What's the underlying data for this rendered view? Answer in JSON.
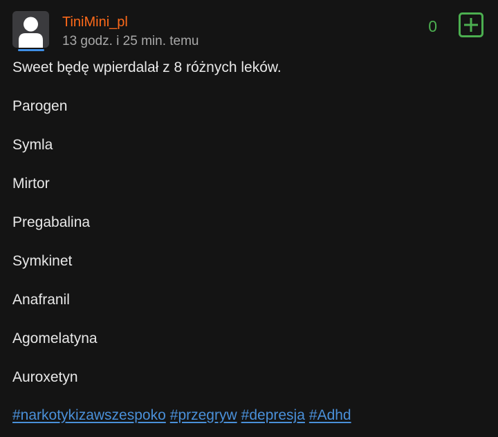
{
  "post": {
    "author": "TiniMini_pl",
    "timestamp": "13 godz. i 25 min. temu",
    "votes": "0",
    "lines": [
      "Sweet będę wpierdalał z 8 różnych leków.",
      "Parogen",
      "Symla",
      "Mirtor",
      "Pregabalina",
      "Symkinet",
      "Anafranil",
      "Agomelatyna",
      "Auroxetyn"
    ],
    "tags": [
      "#narkotykizawszespoko",
      "#przegryw",
      "#depresja",
      "#Adhd"
    ]
  },
  "colors": {
    "author": "#ff6a1a",
    "votes": "#4caf50",
    "tag": "#4a90d9",
    "avatar_bg": "#3b3b3e",
    "avatar_underline": "#3f8fe6"
  },
  "icons": {
    "avatar": "default-user-avatar-icon",
    "plus": "plus-square-icon"
  }
}
